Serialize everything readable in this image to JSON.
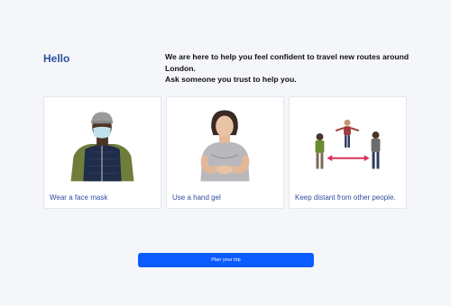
{
  "header": {
    "greeting": "Hello",
    "intro_line1": "We are here to help you feel confident to travel new routes around London.",
    "intro_line2": "Ask someone you trust to help you."
  },
  "cards": [
    {
      "caption": "Wear a face mask",
      "icon": "person-face-mask-icon"
    },
    {
      "caption": "Use a hand gel",
      "icon": "person-hand-gel-icon"
    },
    {
      "caption": "Keep distant from other people.",
      "icon": "people-distancing-icon"
    }
  ],
  "actions": {
    "plan_label": "Plan your trip"
  },
  "colors": {
    "accent": "#2f4f9e",
    "button": "#0b5cff",
    "background": "#f4f6fa",
    "distance_arrow": "#d9325a"
  }
}
